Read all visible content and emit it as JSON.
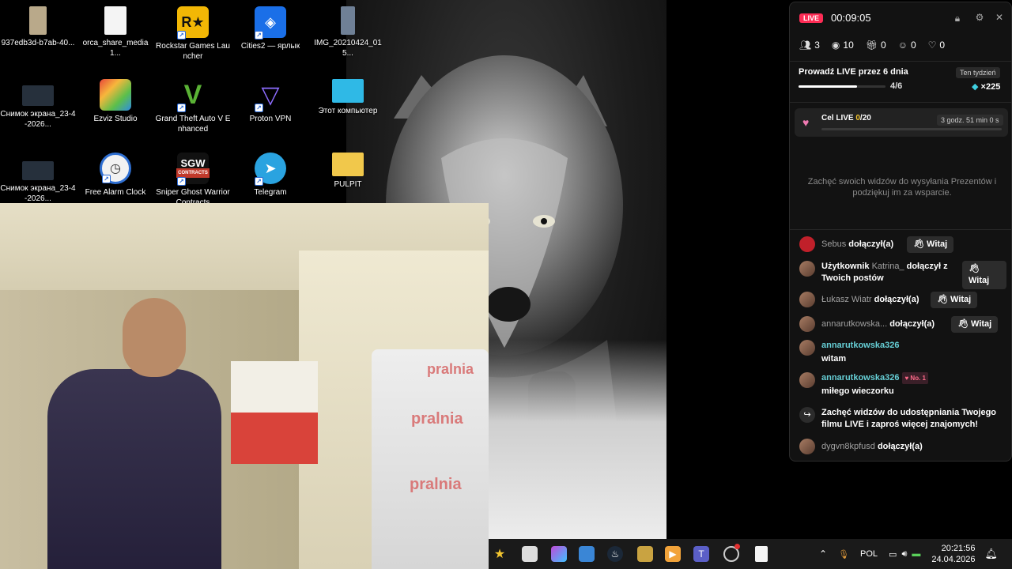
{
  "desktop": {
    "icons": [
      {
        "label": "937edb3d-b7ab-40..."
      },
      {
        "label": "orca_share_media1..."
      },
      {
        "label": "Rockstar Games Launcher"
      },
      {
        "label": "Cities2 — ярлык"
      },
      {
        "label": "IMG_20210424_015..."
      },
      {
        "label": "Снимок экрана_23-4-2026..."
      },
      {
        "label": "Ezviz Studio"
      },
      {
        "label": "Grand Theft Auto V Enhanced"
      },
      {
        "label": "Proton VPN"
      },
      {
        "label": "Этот компьютер"
      },
      {
        "label": "Снимок экрана_23-4-2026..."
      },
      {
        "label": "Free Alarm Clock"
      },
      {
        "label": "Sniper Ghost Warrior Contracts"
      },
      {
        "label": "Telegram"
      },
      {
        "label": "PULPIT"
      }
    ],
    "webcam_texts": {
      "bag1": "pralnia",
      "bag2": "pralnia",
      "bag3": "pralnia",
      "logo": "SGW",
      "logo_sub": "CONTRACTS"
    }
  },
  "panel": {
    "live_label": "LIVE",
    "timer": "00:09:05",
    "stats": {
      "viewers": "3",
      "views": "10",
      "gifts": "0",
      "shares": "0",
      "likes": "0"
    },
    "streak": {
      "title": "Prowadź LIVE przez 6 dnia",
      "badge": "Ten tydzień",
      "count": "4/6",
      "reward": "×225",
      "progress": 0.67
    },
    "goal": {
      "label": "Cel LIVE ",
      "current": "0",
      "total": "/20",
      "time_left": "3 godz. 51 min 0 s",
      "progress": 0
    },
    "gift_hint": "Zachęć swoich widzów do wysyłania Prezentów i podziękuj im za wsparcie.",
    "feed": [
      {
        "user": "Sebus",
        "action": " dołączył(a)",
        "button": "Witaj"
      },
      {
        "prefix": "Użytkownik ",
        "user": "Katrina_",
        "action": " dołączył z Twoich postów",
        "button": "Witaj"
      },
      {
        "user": "Łukasz Wiatr",
        "action": " dołączył(a)",
        "button": "Witaj"
      },
      {
        "user": "annarutkowska...",
        "action": "  dołączył(a)",
        "button": "Witaj"
      },
      {
        "user": "annarutkowska326",
        "message": "witam"
      },
      {
        "user": "annarutkowska326",
        "badge": "No. 1",
        "message": "miłego wieczorku"
      },
      {
        "message": "Zachęć widzów do udostępniania Twojego filmu LIVE i zaproś więcej znajomych!"
      },
      {
        "user": "dygvn8kpfusd",
        "action": " dołączył(a)"
      }
    ]
  },
  "taskbar": {
    "language": "POL",
    "time": "20:21:56",
    "date": "24.04.2026"
  }
}
